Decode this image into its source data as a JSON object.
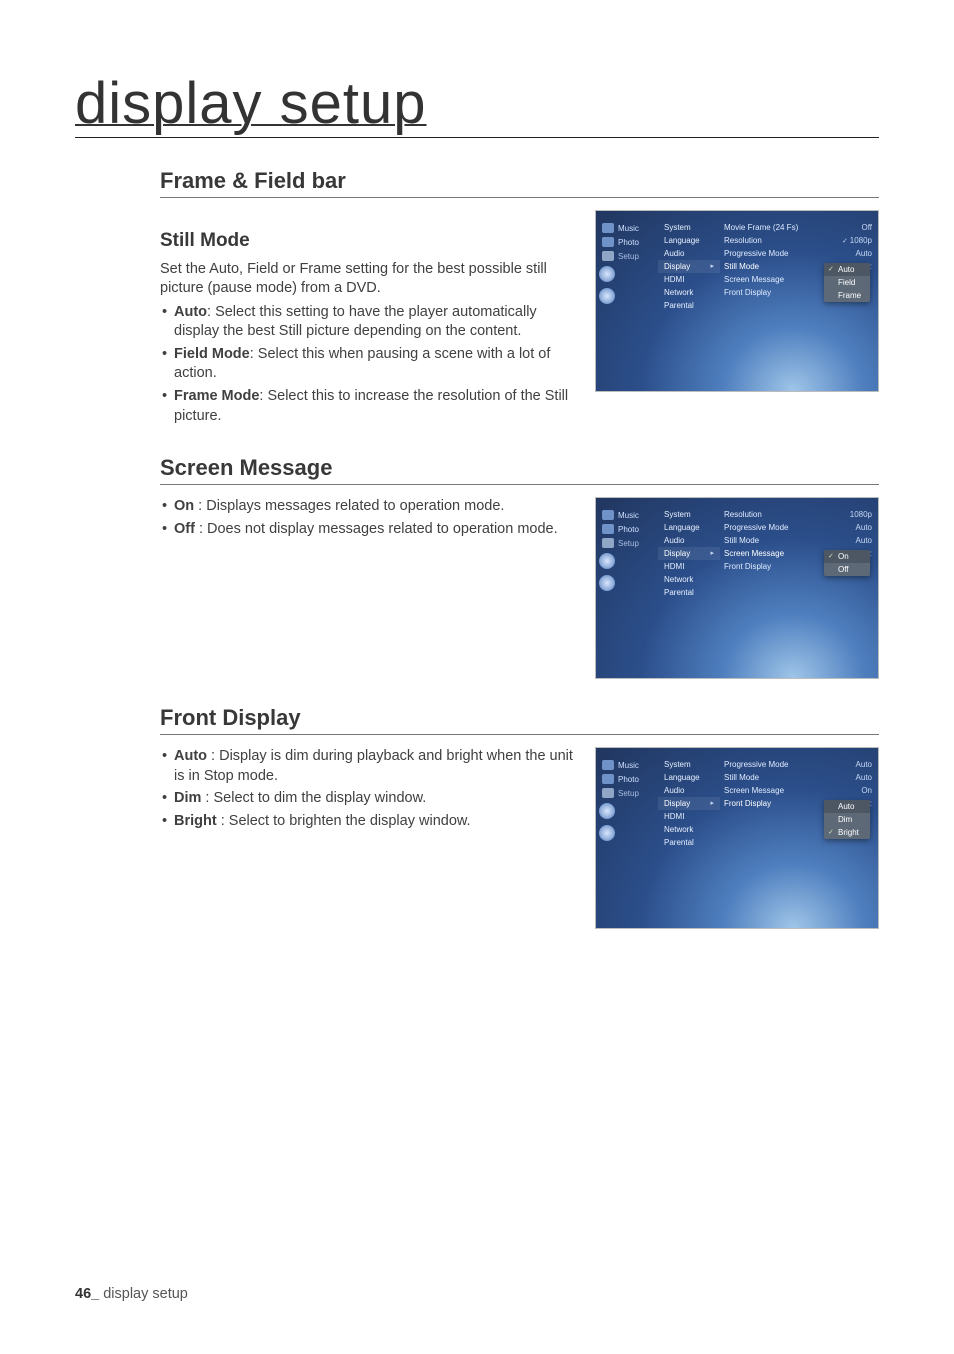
{
  "page": {
    "title": "display setup",
    "footer_page": "46_",
    "footer_text": "display setup"
  },
  "frame_field": {
    "heading": "Frame & Field bar"
  },
  "still_mode": {
    "heading": "Still Mode",
    "intro": "Set the Auto, Field or Frame setting for the best possible still picture (pause mode) from a DVD.",
    "b1_bold": "Auto",
    "b1_rest": ": Select this setting to have the player automatically display the best Still picture depending on the content.",
    "b2_bold": "Field Mode",
    "b2_rest": ": Select this when pausing a scene with a lot of action.",
    "b3_bold": "Frame Mode",
    "b3_rest": ": Select this to increase the resolution of the Still picture."
  },
  "screen_message": {
    "heading": "Screen Message",
    "b1_bold": "On",
    "b1_rest": " : Displays messages related to operation mode.",
    "b2_bold": "Off",
    "b2_rest": " : Does not display messages related to operation mode."
  },
  "front_display": {
    "heading": "Front Display",
    "b1_bold": "Auto",
    "b1_rest": " : Display is dim during playback and bright when the unit is in Stop mode.",
    "b2_bold": "Dim",
    "b2_rest": " : Select to dim the display window.",
    "b3_bold": "Bright",
    "b3_rest": " : Select to brighten the display window."
  },
  "ui_common": {
    "left_music": "Music",
    "left_photo": "Photo",
    "left_setup": "Setup",
    "mid_system": "System",
    "mid_language": "Language",
    "mid_audio": "Audio",
    "mid_display": "Display",
    "mid_hdmi": "HDMI",
    "mid_network": "Network",
    "mid_parental": "Parental"
  },
  "ui1": {
    "r1_l": "Movie Frame (24 Fs)",
    "r1_v": "Off",
    "r2_l": "Resolution",
    "r2_v": "1080p",
    "r3_l": "Progressive Mode",
    "r3_v": "Auto",
    "r4_l": "Still Mode",
    "r4_v": "",
    "r5_l": "Screen Message",
    "r6_l": "Front Display",
    "opt1": "Auto",
    "opt2": "Field",
    "opt3": "Frame"
  },
  "ui2": {
    "r1_l": "Resolution",
    "r1_v": "1080p",
    "r2_l": "Progressive Mode",
    "r2_v": "Auto",
    "r3_l": "Still Mode",
    "r3_v": "Auto",
    "r4_l": "Screen Message",
    "r4_v": "",
    "r5_l": "Front Display",
    "opt1": "On",
    "opt2": "Off"
  },
  "ui3": {
    "r1_l": "Progressive Mode",
    "r1_v": "Auto",
    "r2_l": "Still Mode",
    "r2_v": "Auto",
    "r3_l": "Screen Message",
    "r3_v": "On",
    "r4_l": "Front Display",
    "r4_v": "",
    "opt1": "Auto",
    "opt2": "Dim",
    "opt3": "Bright"
  }
}
